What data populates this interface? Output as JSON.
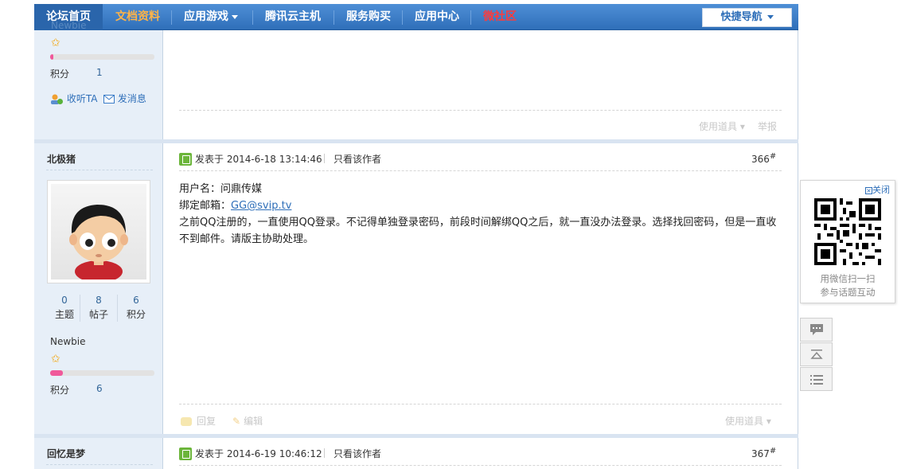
{
  "nav": {
    "items": [
      {
        "label": "论坛首页"
      },
      {
        "label": "文档资料"
      },
      {
        "label": "应用游戏"
      },
      {
        "label": "腾讯云主机"
      },
      {
        "label": "服务购买"
      },
      {
        "label": "应用中心"
      },
      {
        "label": "微社区"
      }
    ],
    "quick_nav": "快捷导航",
    "ghost_text": "Newbie"
  },
  "prev_post": {
    "score_label": "积分",
    "score_value": "1",
    "follow_label": "收听TA",
    "message_label": "发消息",
    "use_tool": "使用道具",
    "report": "举报",
    "level_progress": 0.03
  },
  "post1": {
    "author": "北极猪",
    "stats": [
      {
        "value": "0",
        "label": "主题"
      },
      {
        "value": "8",
        "label": "帖子"
      },
      {
        "value": "6",
        "label": "积分"
      }
    ],
    "rank": "Newbie",
    "level_progress": 0.12,
    "score_label": "积分",
    "score_value": "6",
    "posted_at": "发表于 2014-6-18 13:14:46",
    "only_author": "只看该作者",
    "floor": "366",
    "floor_mark": "#",
    "content": {
      "line1": "用户名：问鼎传媒",
      "line2_prefix": "绑定邮箱：",
      "email": "GG@svip.tv",
      "line3": "之前QQ注册的，一直使用QQ登录。不记得单独登录密码，前段时间解绑QQ之后，就一直没办法登录。选择找回密码，但是一直收不到邮件。请版主协助处理。"
    },
    "reply": "回复",
    "edit": "编辑",
    "use_tool": "使用道具"
  },
  "post2": {
    "author": "回忆是梦",
    "posted_at": "发表于 2014-6-19 10:46:12",
    "only_author": "只看该作者",
    "floor": "367",
    "floor_mark": "#"
  },
  "qr": {
    "close": "关闭",
    "caption1": "用微信扫一扫",
    "caption2": "参与话题互动"
  },
  "colors": {
    "nav_bg": "#3a7cc8",
    "side_bg": "#e7eff8",
    "link": "#2f6fb9",
    "progress": "#f0599a"
  }
}
